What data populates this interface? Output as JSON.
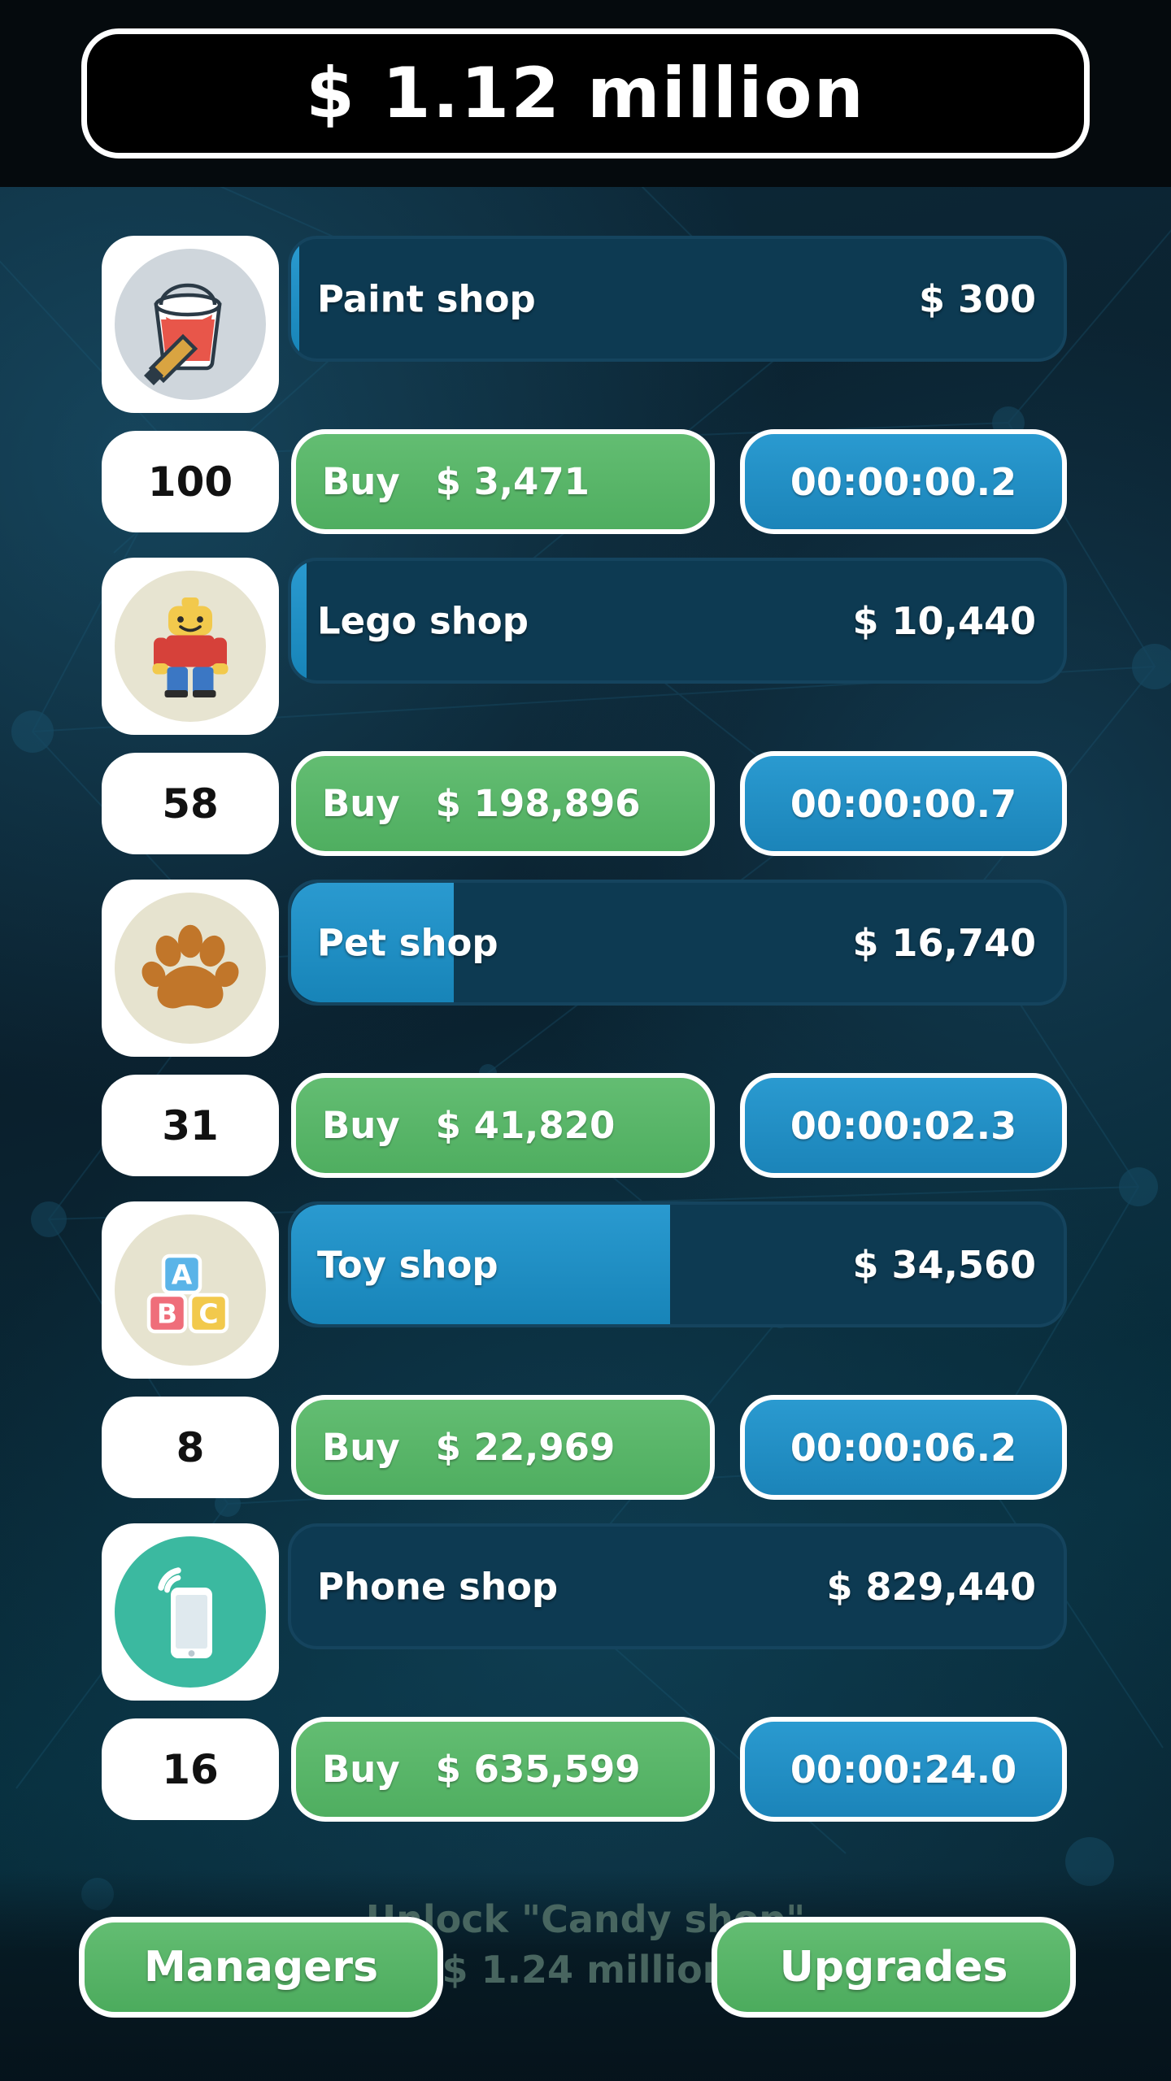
{
  "header": {
    "money": "$ 1.12 million"
  },
  "shops": [
    {
      "name": "Paint shop",
      "icon": "paint-bucket-icon",
      "icon_bg": "#cfd6dc",
      "count": "100",
      "revenue": "$ 300",
      "progress_pct": 1,
      "buy_label": "Buy",
      "buy_price": "$ 3,471",
      "timer": "00:00:00.2"
    },
    {
      "name": "Lego shop",
      "icon": "lego-figure-icon",
      "icon_bg": "#e7e4d1",
      "count": "58",
      "revenue": "$ 10,440",
      "progress_pct": 2,
      "buy_label": "Buy",
      "buy_price": "$ 198,896",
      "timer": "00:00:00.7"
    },
    {
      "name": "Pet shop",
      "icon": "paw-print-icon",
      "icon_bg": "#e6e3cf",
      "count": "31",
      "revenue": "$ 16,740",
      "progress_pct": 21,
      "buy_label": "Buy",
      "buy_price": "$ 41,820",
      "timer": "00:00:02.3"
    },
    {
      "name": "Toy shop",
      "icon": "abc-blocks-icon",
      "icon_bg": "#e6e3cf",
      "count": "8",
      "revenue": "$ 34,560",
      "progress_pct": 49,
      "buy_label": "Buy",
      "buy_price": "$ 22,969",
      "timer": "00:00:06.2"
    },
    {
      "name": "Phone shop",
      "icon": "smartphone-icon",
      "icon_bg": "#3bb9a0",
      "count": "16",
      "revenue": "$ 829,440",
      "progress_pct": 0,
      "buy_label": "Buy",
      "buy_price": "$ 635,599",
      "timer": "00:00:24.0"
    }
  ],
  "bottom": {
    "unlock_note_line1": "Unlock \"Candy shop\"",
    "unlock_note_line2": "$ 1.24 million",
    "managers_label": "Managers",
    "upgrades_label": "Upgrades"
  },
  "colors": {
    "accent_blue": "#2a9ad0",
    "buy_green": "#55b264",
    "bg_dark": "#0b2230"
  }
}
